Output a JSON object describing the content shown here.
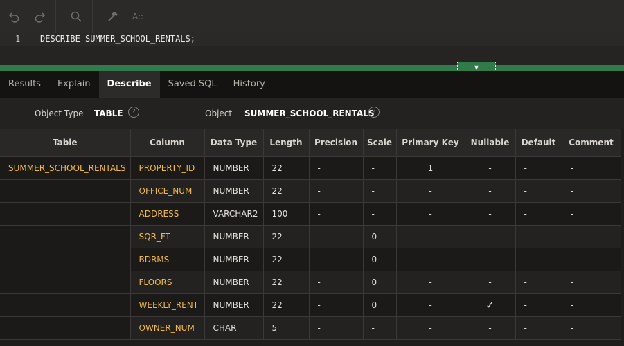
{
  "toolbar": {
    "icons": [
      "undo-icon",
      "redo-icon",
      "search-icon",
      "hammer-icon",
      "font-size-icon"
    ],
    "font_size_glyph": "A::"
  },
  "editor": {
    "line_number": "1",
    "code": "DESCRIBE SUMMER_SCHOOL_RENTALS;"
  },
  "tabs": [
    {
      "label": "Results"
    },
    {
      "label": "Explain"
    },
    {
      "label": "Describe"
    },
    {
      "label": "Saved SQL"
    },
    {
      "label": "History"
    }
  ],
  "active_tab": "Describe",
  "object_bar": {
    "object_type_label": "Object Type",
    "object_type_value": "TABLE",
    "object_label": "Object",
    "object_value": "SUMMER_SCHOOL_RENTALS",
    "help_glyph": "?"
  },
  "grid": {
    "headers": [
      "Table",
      "Column",
      "Data Type",
      "Length",
      "Precision",
      "Scale",
      "Primary Key",
      "Nullable",
      "Default",
      "Comment"
    ],
    "rows": [
      {
        "table": "SUMMER_SCHOOL_RENTALS",
        "column": "PROPERTY_ID",
        "data_type": "NUMBER",
        "length": "22",
        "precision": "-",
        "scale": "-",
        "primary_key": "1",
        "nullable": "-",
        "default": "-",
        "comment": "-"
      },
      {
        "table": "",
        "column": "OFFICE_NUM",
        "data_type": "NUMBER",
        "length": "22",
        "precision": "-",
        "scale": "-",
        "primary_key": "-",
        "nullable": "-",
        "default": "-",
        "comment": "-"
      },
      {
        "table": "",
        "column": "ADDRESS",
        "data_type": "VARCHAR2",
        "length": "100",
        "precision": "-",
        "scale": "-",
        "primary_key": "-",
        "nullable": "-",
        "default": "-",
        "comment": "-"
      },
      {
        "table": "",
        "column": "SQR_FT",
        "data_type": "NUMBER",
        "length": "22",
        "precision": "-",
        "scale": "0",
        "primary_key": "-",
        "nullable": "-",
        "default": "-",
        "comment": "-"
      },
      {
        "table": "",
        "column": "BDRMS",
        "data_type": "NUMBER",
        "length": "22",
        "precision": "-",
        "scale": "0",
        "primary_key": "-",
        "nullable": "-",
        "default": "-",
        "comment": "-"
      },
      {
        "table": "",
        "column": "FLOORS",
        "data_type": "NUMBER",
        "length": "22",
        "precision": "-",
        "scale": "0",
        "primary_key": "-",
        "nullable": "-",
        "default": "-",
        "comment": "-"
      },
      {
        "table": "",
        "column": "WEEKLY_RENT",
        "data_type": "NUMBER",
        "length": "22",
        "precision": "-",
        "scale": "0",
        "primary_key": "-",
        "nullable": "✓",
        "default": "-",
        "comment": "-"
      },
      {
        "table": "",
        "column": "OWNER_NUM",
        "data_type": "CHAR",
        "length": "5",
        "precision": "-",
        "scale": "-",
        "primary_key": "-",
        "nullable": "-",
        "default": "-",
        "comment": "-"
      }
    ]
  }
}
